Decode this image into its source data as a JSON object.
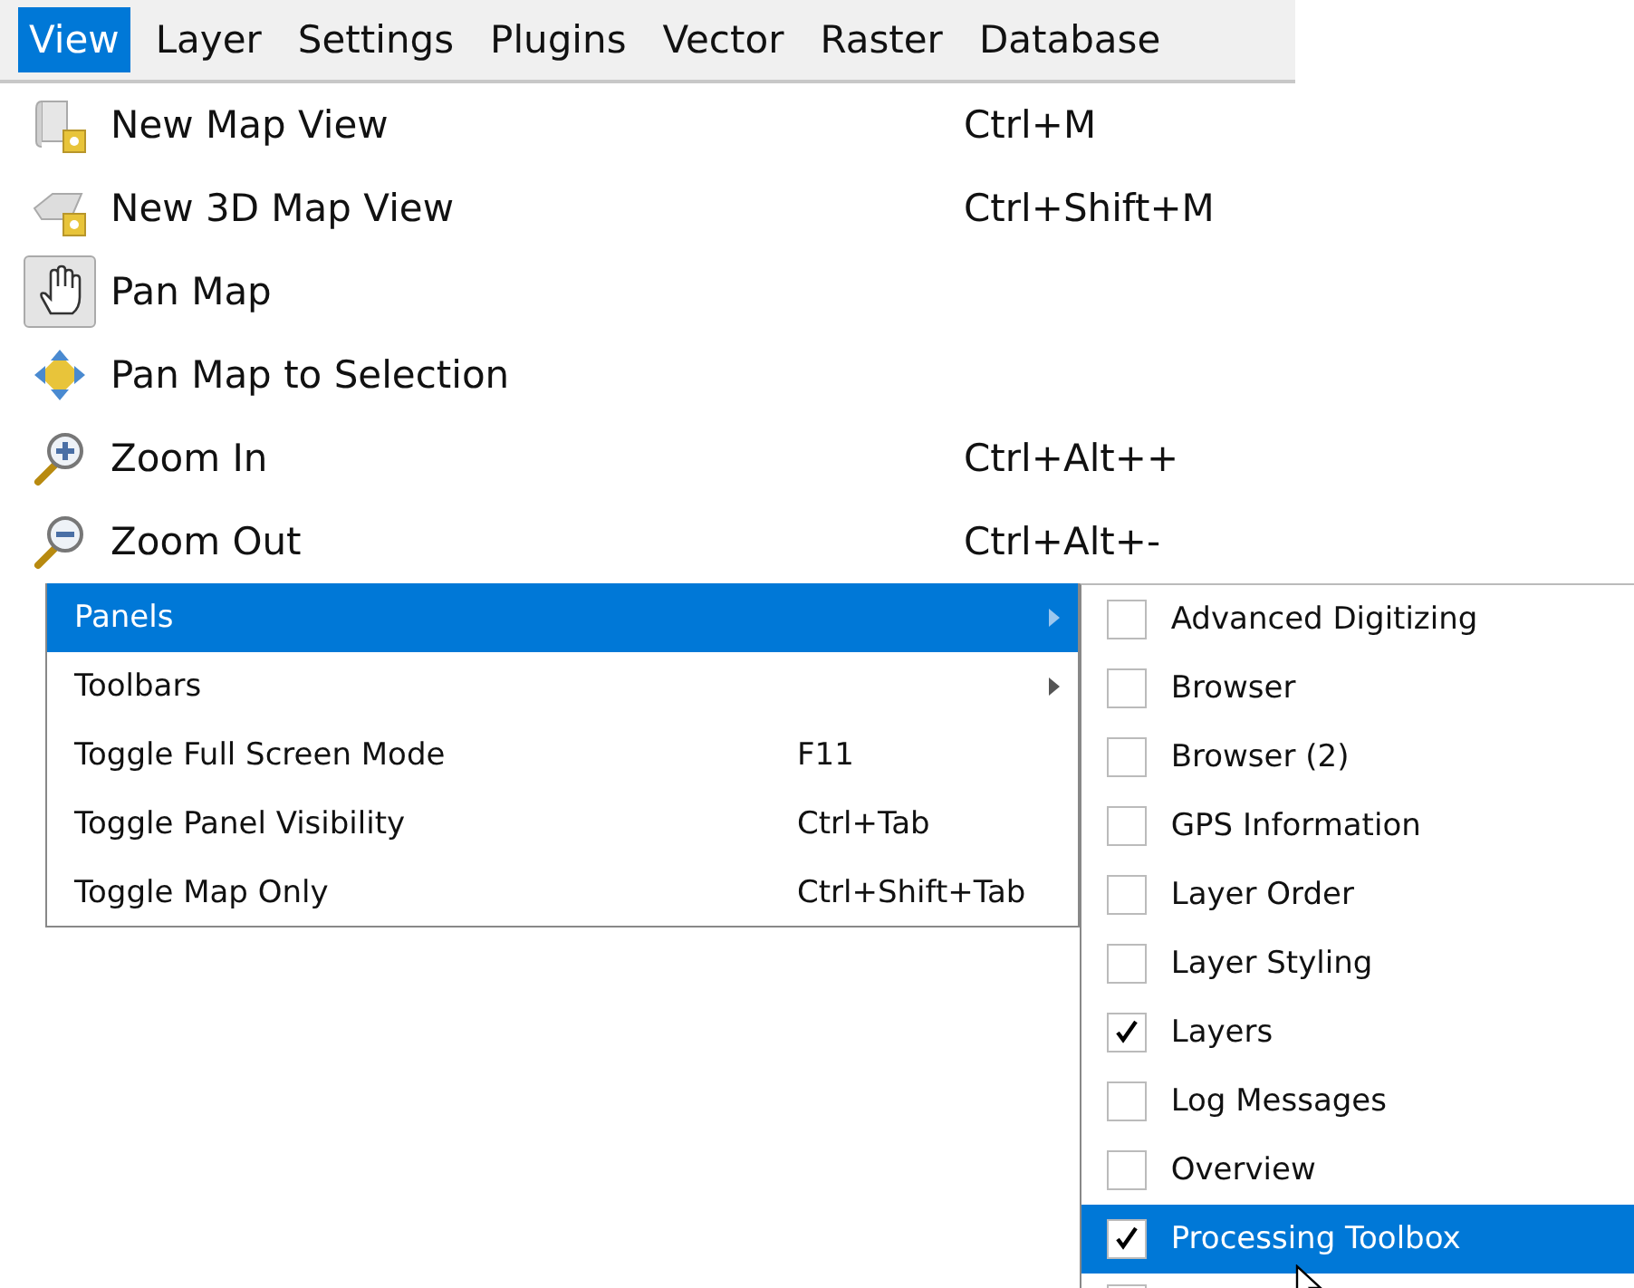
{
  "menubar": [
    {
      "label": "View",
      "selected": true
    },
    {
      "label": "Layer",
      "selected": false
    },
    {
      "label": "Settings",
      "selected": false
    },
    {
      "label": "Plugins",
      "selected": false
    },
    {
      "label": "Vector",
      "selected": false
    },
    {
      "label": "Raster",
      "selected": false
    },
    {
      "label": "Database",
      "selected": false
    }
  ],
  "view_menu": [
    {
      "label": "New Map View",
      "shortcut": "Ctrl+M",
      "checked": false
    },
    {
      "label": "New 3D Map View",
      "shortcut": "Ctrl+Shift+M",
      "checked": false
    },
    {
      "label": "Pan Map",
      "checked": true
    },
    {
      "label": "Pan Map to Selection",
      "checked": false
    },
    {
      "label": "Zoom In",
      "shortcut": "Ctrl+Alt++",
      "checked": false
    },
    {
      "label": "Zoom Out",
      "shortcut": "Ctrl+Alt+-",
      "checked": false
    }
  ],
  "sub_menu": [
    {
      "label": "Panels",
      "submenu": true,
      "selected": true
    },
    {
      "label": "Toolbars",
      "submenu": true,
      "selected": false
    },
    {
      "label": "Toggle Full Screen Mode",
      "shortcut": "F11",
      "submenu": false,
      "selected": false
    },
    {
      "label": "Toggle Panel Visibility",
      "shortcut": "Ctrl+Tab",
      "submenu": false,
      "selected": false
    },
    {
      "label": "Toggle Map Only",
      "shortcut": "Ctrl+Shift+Tab",
      "submenu": false,
      "selected": false
    }
  ],
  "panels_menu": [
    {
      "label": "Advanced Digitizing",
      "checked": false,
      "selected": false
    },
    {
      "label": "Browser",
      "checked": false,
      "selected": false
    },
    {
      "label": "Browser (2)",
      "checked": false,
      "selected": false
    },
    {
      "label": "GPS Information",
      "checked": false,
      "selected": false
    },
    {
      "label": "Layer Order",
      "checked": false,
      "selected": false
    },
    {
      "label": "Layer Styling",
      "checked": false,
      "selected": false
    },
    {
      "label": "Layers",
      "checked": true,
      "selected": false
    },
    {
      "label": "Log Messages",
      "checked": false,
      "selected": false
    },
    {
      "label": "Overview",
      "checked": false,
      "selected": false
    },
    {
      "label": "Processing Toolbox",
      "checked": true,
      "selected": true
    }
  ]
}
